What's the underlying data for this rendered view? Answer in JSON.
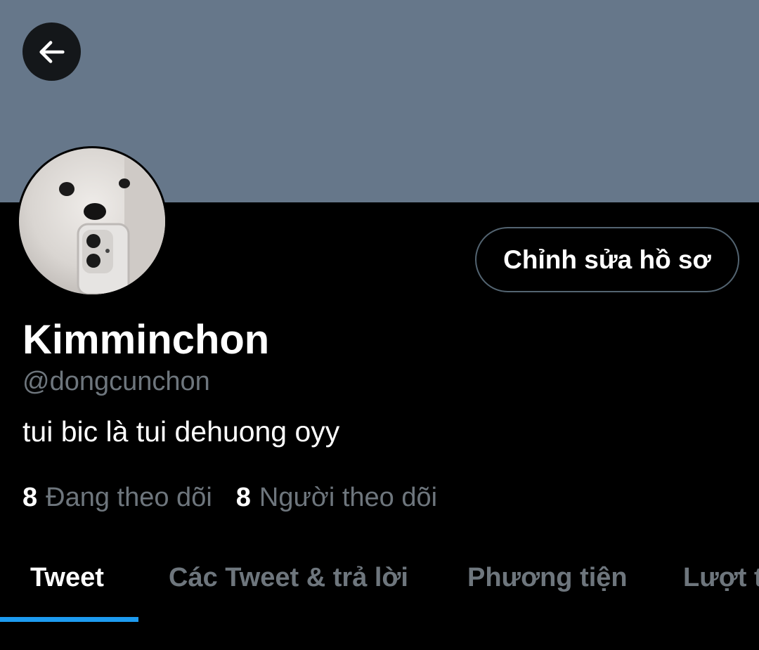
{
  "profile": {
    "display_name": "Kimminchon",
    "handle": "@dongcunchon",
    "bio": "tui bic là tui dehuong oyy",
    "edit_label": "Chỉnh sửa hồ sơ"
  },
  "stats": {
    "following_count": "8",
    "following_label": "Đang theo dõi",
    "followers_count": "8",
    "followers_label": "Người theo dõi"
  },
  "tabs": [
    {
      "label": "Tweet",
      "active": true
    },
    {
      "label": "Các Tweet & trả lời",
      "active": false
    },
    {
      "label": "Phương tiện",
      "active": false
    },
    {
      "label": "Lượt t",
      "active": false
    }
  ],
  "icons": {
    "back": "arrow-left-icon"
  },
  "colors": {
    "banner": "#66778a",
    "background": "#000000",
    "accent": "#1d9bf0",
    "secondary_text": "#6e767d"
  }
}
